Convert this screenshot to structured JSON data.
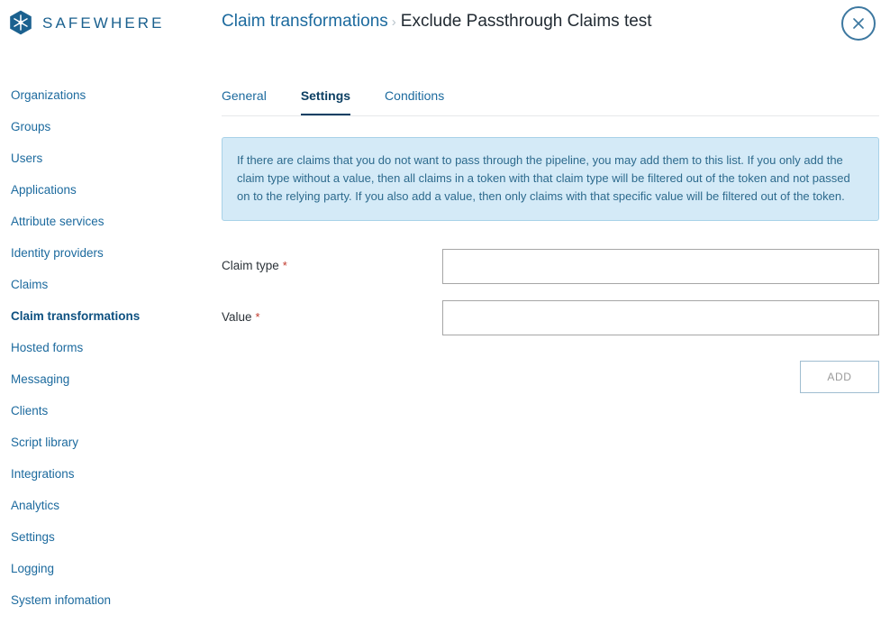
{
  "brand": {
    "name": "SAFEWHERE",
    "logo_icon": "snowflake-hexagon-icon",
    "logo_color": "#1b618f"
  },
  "header": {
    "breadcrumb": {
      "parent": "Claim transformations",
      "separator": "›",
      "current": "Exclude Passthrough Claims test"
    },
    "close_icon": "close-x-icon",
    "close_color": "#3d78a0"
  },
  "sidebar": {
    "items": [
      {
        "label": "Organizations",
        "active": false
      },
      {
        "label": "Groups",
        "active": false
      },
      {
        "label": "Users",
        "active": false
      },
      {
        "label": "Applications",
        "active": false
      },
      {
        "label": "Attribute services",
        "active": false
      },
      {
        "label": "Identity providers",
        "active": false
      },
      {
        "label": "Claims",
        "active": false
      },
      {
        "label": "Claim transformations",
        "active": true
      },
      {
        "label": "Hosted forms",
        "active": false
      },
      {
        "label": "Messaging",
        "active": false
      },
      {
        "label": "Clients",
        "active": false
      },
      {
        "label": "Script library",
        "active": false
      },
      {
        "label": "Integrations",
        "active": false
      },
      {
        "label": "Analytics",
        "active": false
      },
      {
        "label": "Settings",
        "active": false
      },
      {
        "label": "Logging",
        "active": false
      },
      {
        "label": "System infomation",
        "active": false
      }
    ],
    "link_color": "#1c6a9e"
  },
  "main": {
    "tabs": [
      {
        "label": "General",
        "active": false
      },
      {
        "label": "Settings",
        "active": true
      },
      {
        "label": "Conditions",
        "active": false
      }
    ],
    "info_banner": {
      "text": "If there are claims that you do not want to pass through the pipeline, you may add them to this list. If you only add the claim type without a value, then all claims in a token with that claim type will be filtered out of the token and not passed on to the relying party. If you also add a value, then only claims with that specific value will be filtered out of the token.",
      "background": "#d4eaf7",
      "border_color": "#a8d2e8",
      "text_color": "#2d6a8d"
    },
    "form": {
      "required_marker": "*",
      "fields": [
        {
          "label": "Claim type",
          "required": true,
          "value": "",
          "placeholder": ""
        },
        {
          "label": "Value",
          "required": true,
          "value": "",
          "placeholder": ""
        }
      ],
      "add_button": {
        "label": "ADD",
        "disabled": true,
        "text_color": "#9a9a9a",
        "border_color": "#9fbdd0"
      }
    }
  }
}
